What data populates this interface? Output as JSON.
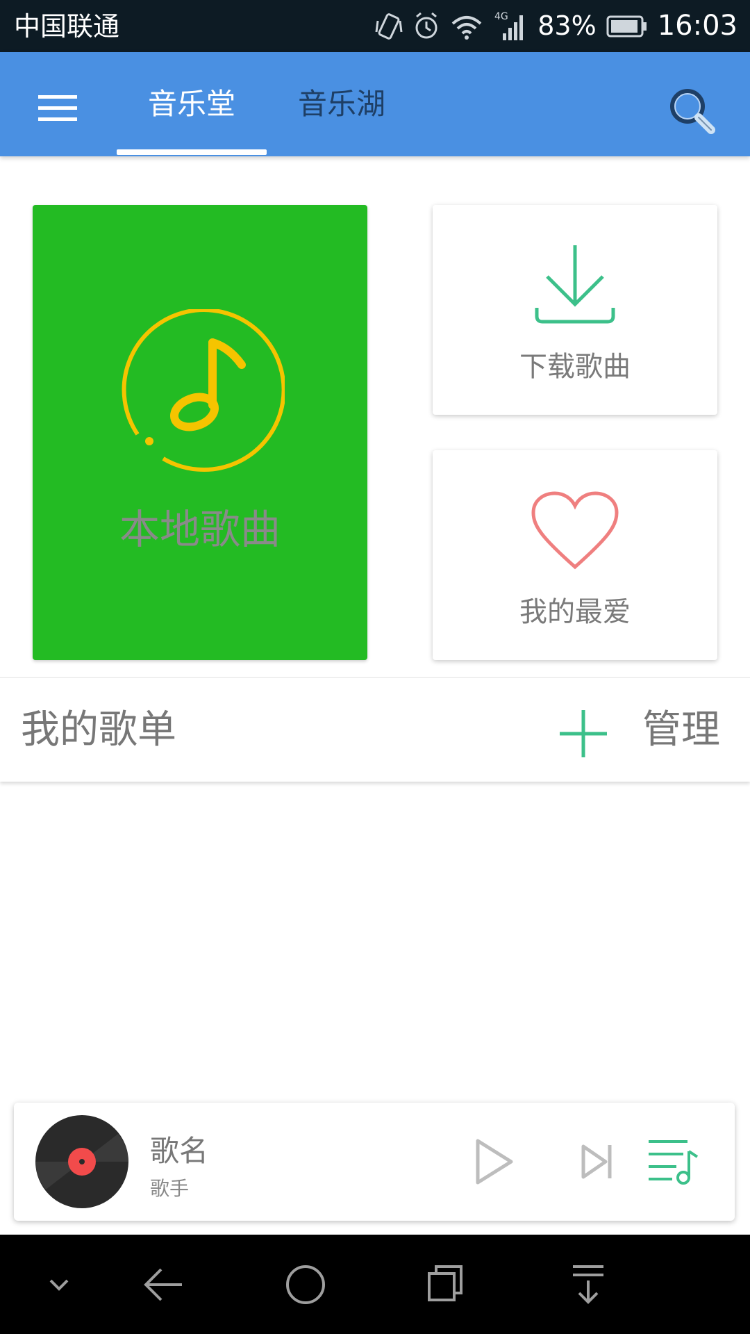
{
  "status_bar": {
    "carrier": "中国联通",
    "network_type": "4G",
    "battery": "83%",
    "time": "16:03"
  },
  "header": {
    "tabs": [
      {
        "label": "音乐堂",
        "selected": true
      },
      {
        "label": "音乐湖",
        "selected": false
      }
    ]
  },
  "tiles": {
    "local_songs": {
      "label": "本地歌曲",
      "icon": "music-note-icon"
    },
    "downloaded_songs": {
      "label": "下载歌曲",
      "icon": "download-icon"
    },
    "favorites": {
      "label": "我的最爱",
      "icon": "heart-icon"
    }
  },
  "playlists": {
    "title": "我的歌单",
    "manage_label": "管理"
  },
  "player": {
    "song": "歌名",
    "artist": "歌手"
  },
  "colors": {
    "app_bar": "#4a90e2",
    "local_tile": "#23bb23",
    "accent_green": "#3cc08a",
    "note_yellow": "#f5c400",
    "heart_pink": "#ef7f7f"
  }
}
